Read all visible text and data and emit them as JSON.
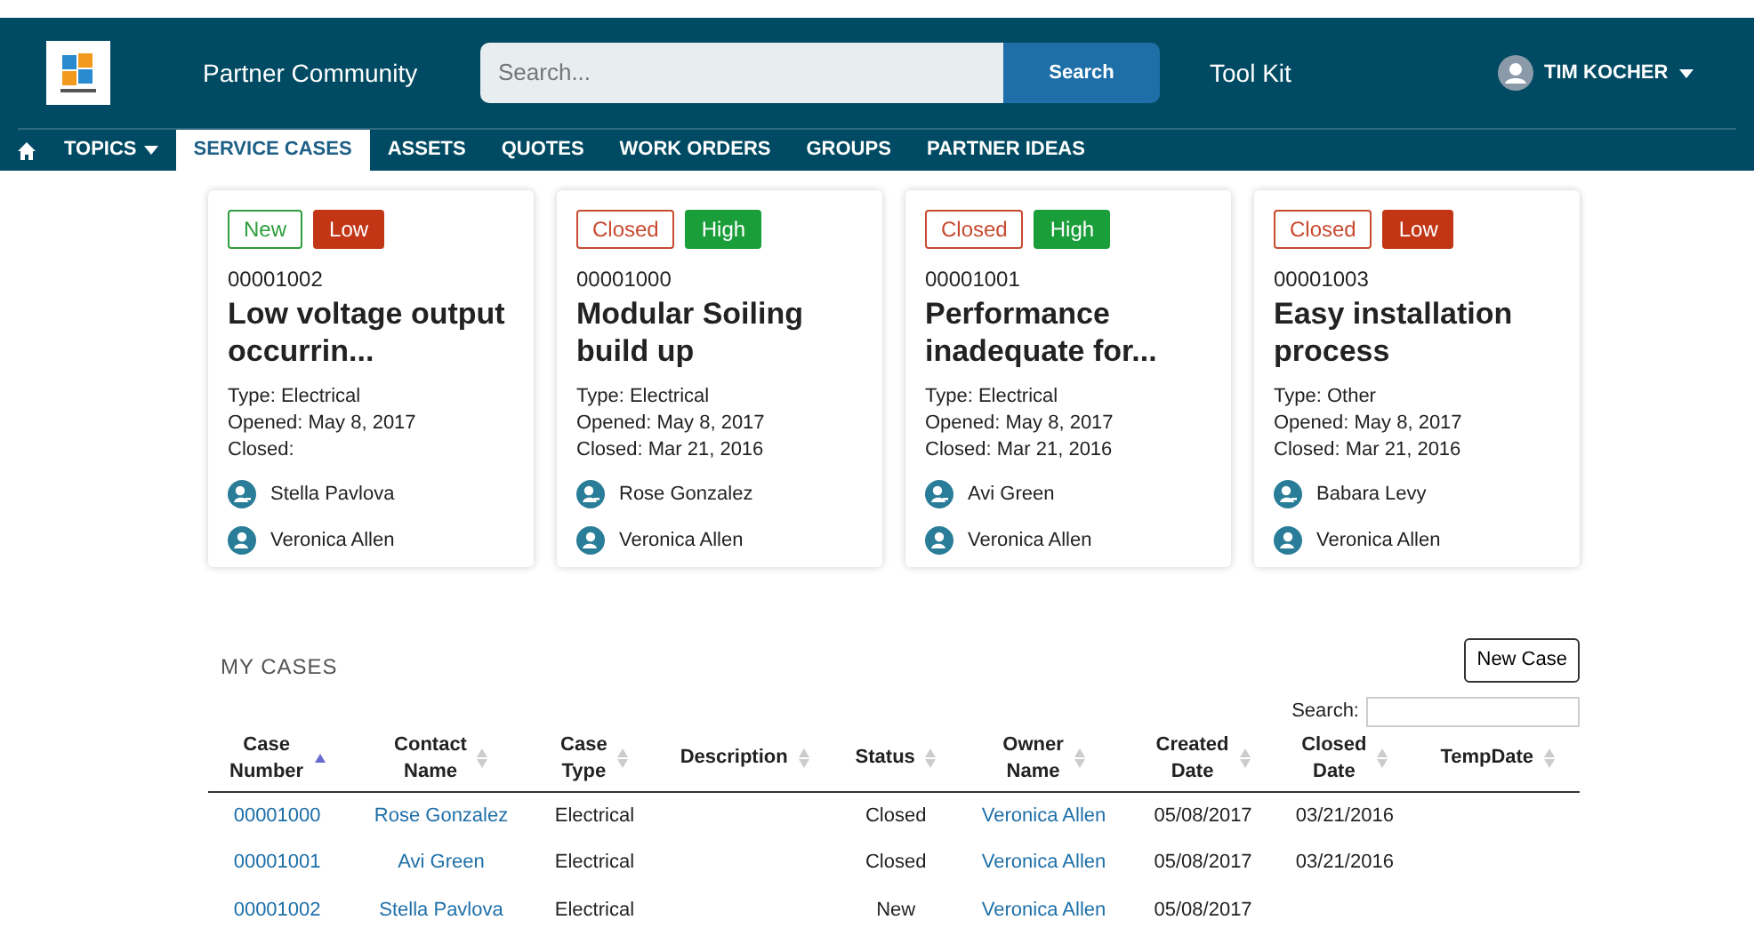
{
  "header": {
    "site_name": "Partner Community",
    "search": {
      "placeholder": "Search...",
      "button": "Search"
    },
    "link": "Tool Kit",
    "user": "TIM KOCHER"
  },
  "tabs": [
    {
      "label": "TOPICS",
      "selected": false,
      "dropdown": true
    },
    {
      "label": "SERVICE CASES",
      "selected": true,
      "dropdown": false
    },
    {
      "label": "ASSETS",
      "selected": false,
      "dropdown": false
    },
    {
      "label": "QUOTES",
      "selected": false,
      "dropdown": false
    },
    {
      "label": "WORK ORDERS",
      "selected": false,
      "dropdown": false
    },
    {
      "label": "GROUPS",
      "selected": false,
      "dropdown": false
    },
    {
      "label": "PARTNER IDEAS",
      "selected": false,
      "dropdown": false
    }
  ],
  "cards": [
    {
      "tags": [
        {
          "label": "New",
          "kind": "outline",
          "color": "#2e9e3e"
        },
        {
          "label": "Low",
          "kind": "solid",
          "color": "#c23616"
        }
      ],
      "number": "00001002",
      "title": "Low voltage output occurrin...",
      "type": "Type: Electrical",
      "opened": "Opened: May 8, 2017",
      "closed": "Closed:",
      "contact": "Stella Pavlova",
      "owner": "Veronica Allen"
    },
    {
      "tags": [
        {
          "label": "Closed",
          "kind": "outline",
          "color": "#c84a30"
        },
        {
          "label": "High",
          "kind": "solid",
          "color": "#1a9e3a"
        }
      ],
      "number": "00001000",
      "title": "Modular Soiling build up",
      "type": "Type: Electrical",
      "opened": "Opened: May 8, 2017",
      "closed": "Closed: Mar 21, 2016",
      "contact": "Rose Gonzalez",
      "owner": "Veronica Allen"
    },
    {
      "tags": [
        {
          "label": "Closed",
          "kind": "outline",
          "color": "#c84a30"
        },
        {
          "label": "High",
          "kind": "solid",
          "color": "#1a9e3a"
        }
      ],
      "number": "00001001",
      "title": "Performance inadequate for...",
      "type": "Type: Electrical",
      "opened": "Opened: May 8, 2017",
      "closed": "Closed: Mar 21, 2016",
      "contact": "Avi Green",
      "owner": "Veronica Allen"
    },
    {
      "tags": [
        {
          "label": "Closed",
          "kind": "outline",
          "color": "#c84a30"
        },
        {
          "label": "Low",
          "kind": "solid",
          "color": "#c23616"
        }
      ],
      "number": "00001003",
      "title": "Easy installation process",
      "type": "Type: Other",
      "opened": "Opened: May 8, 2017",
      "closed": "Closed: Mar 21, 2016",
      "contact": "Babara Levy",
      "owner": "Veronica Allen"
    }
  ],
  "my_cases": {
    "title": "MY CASES",
    "new_button": "New Case",
    "search_label": "Search:",
    "columns": [
      {
        "label": "Case Number",
        "sorted": true
      },
      {
        "label": "Contact Name",
        "sorted": false
      },
      {
        "label": "Case Type",
        "sorted": false
      },
      {
        "label": "Description",
        "sorted": false
      },
      {
        "label": "Status",
        "sorted": false
      },
      {
        "label": "Owner Name",
        "sorted": false
      },
      {
        "label": "Created Date",
        "sorted": false
      },
      {
        "label": "Closed Date",
        "sorted": false
      },
      {
        "label": "TempDate",
        "sorted": false
      }
    ],
    "rows": [
      [
        "00001000",
        "Rose Gonzalez",
        "Electrical",
        "",
        "Closed",
        "Veronica Allen",
        "05/08/2017",
        "03/21/2016",
        ""
      ],
      [
        "00001001",
        "Avi Green",
        "Electrical",
        "",
        "Closed",
        "Veronica Allen",
        "05/08/2017",
        "03/21/2016",
        ""
      ],
      [
        "00001002",
        "Stella Pavlova",
        "Electrical",
        "",
        "New",
        "Veronica Allen",
        "05/08/2017",
        "",
        ""
      ]
    ]
  }
}
